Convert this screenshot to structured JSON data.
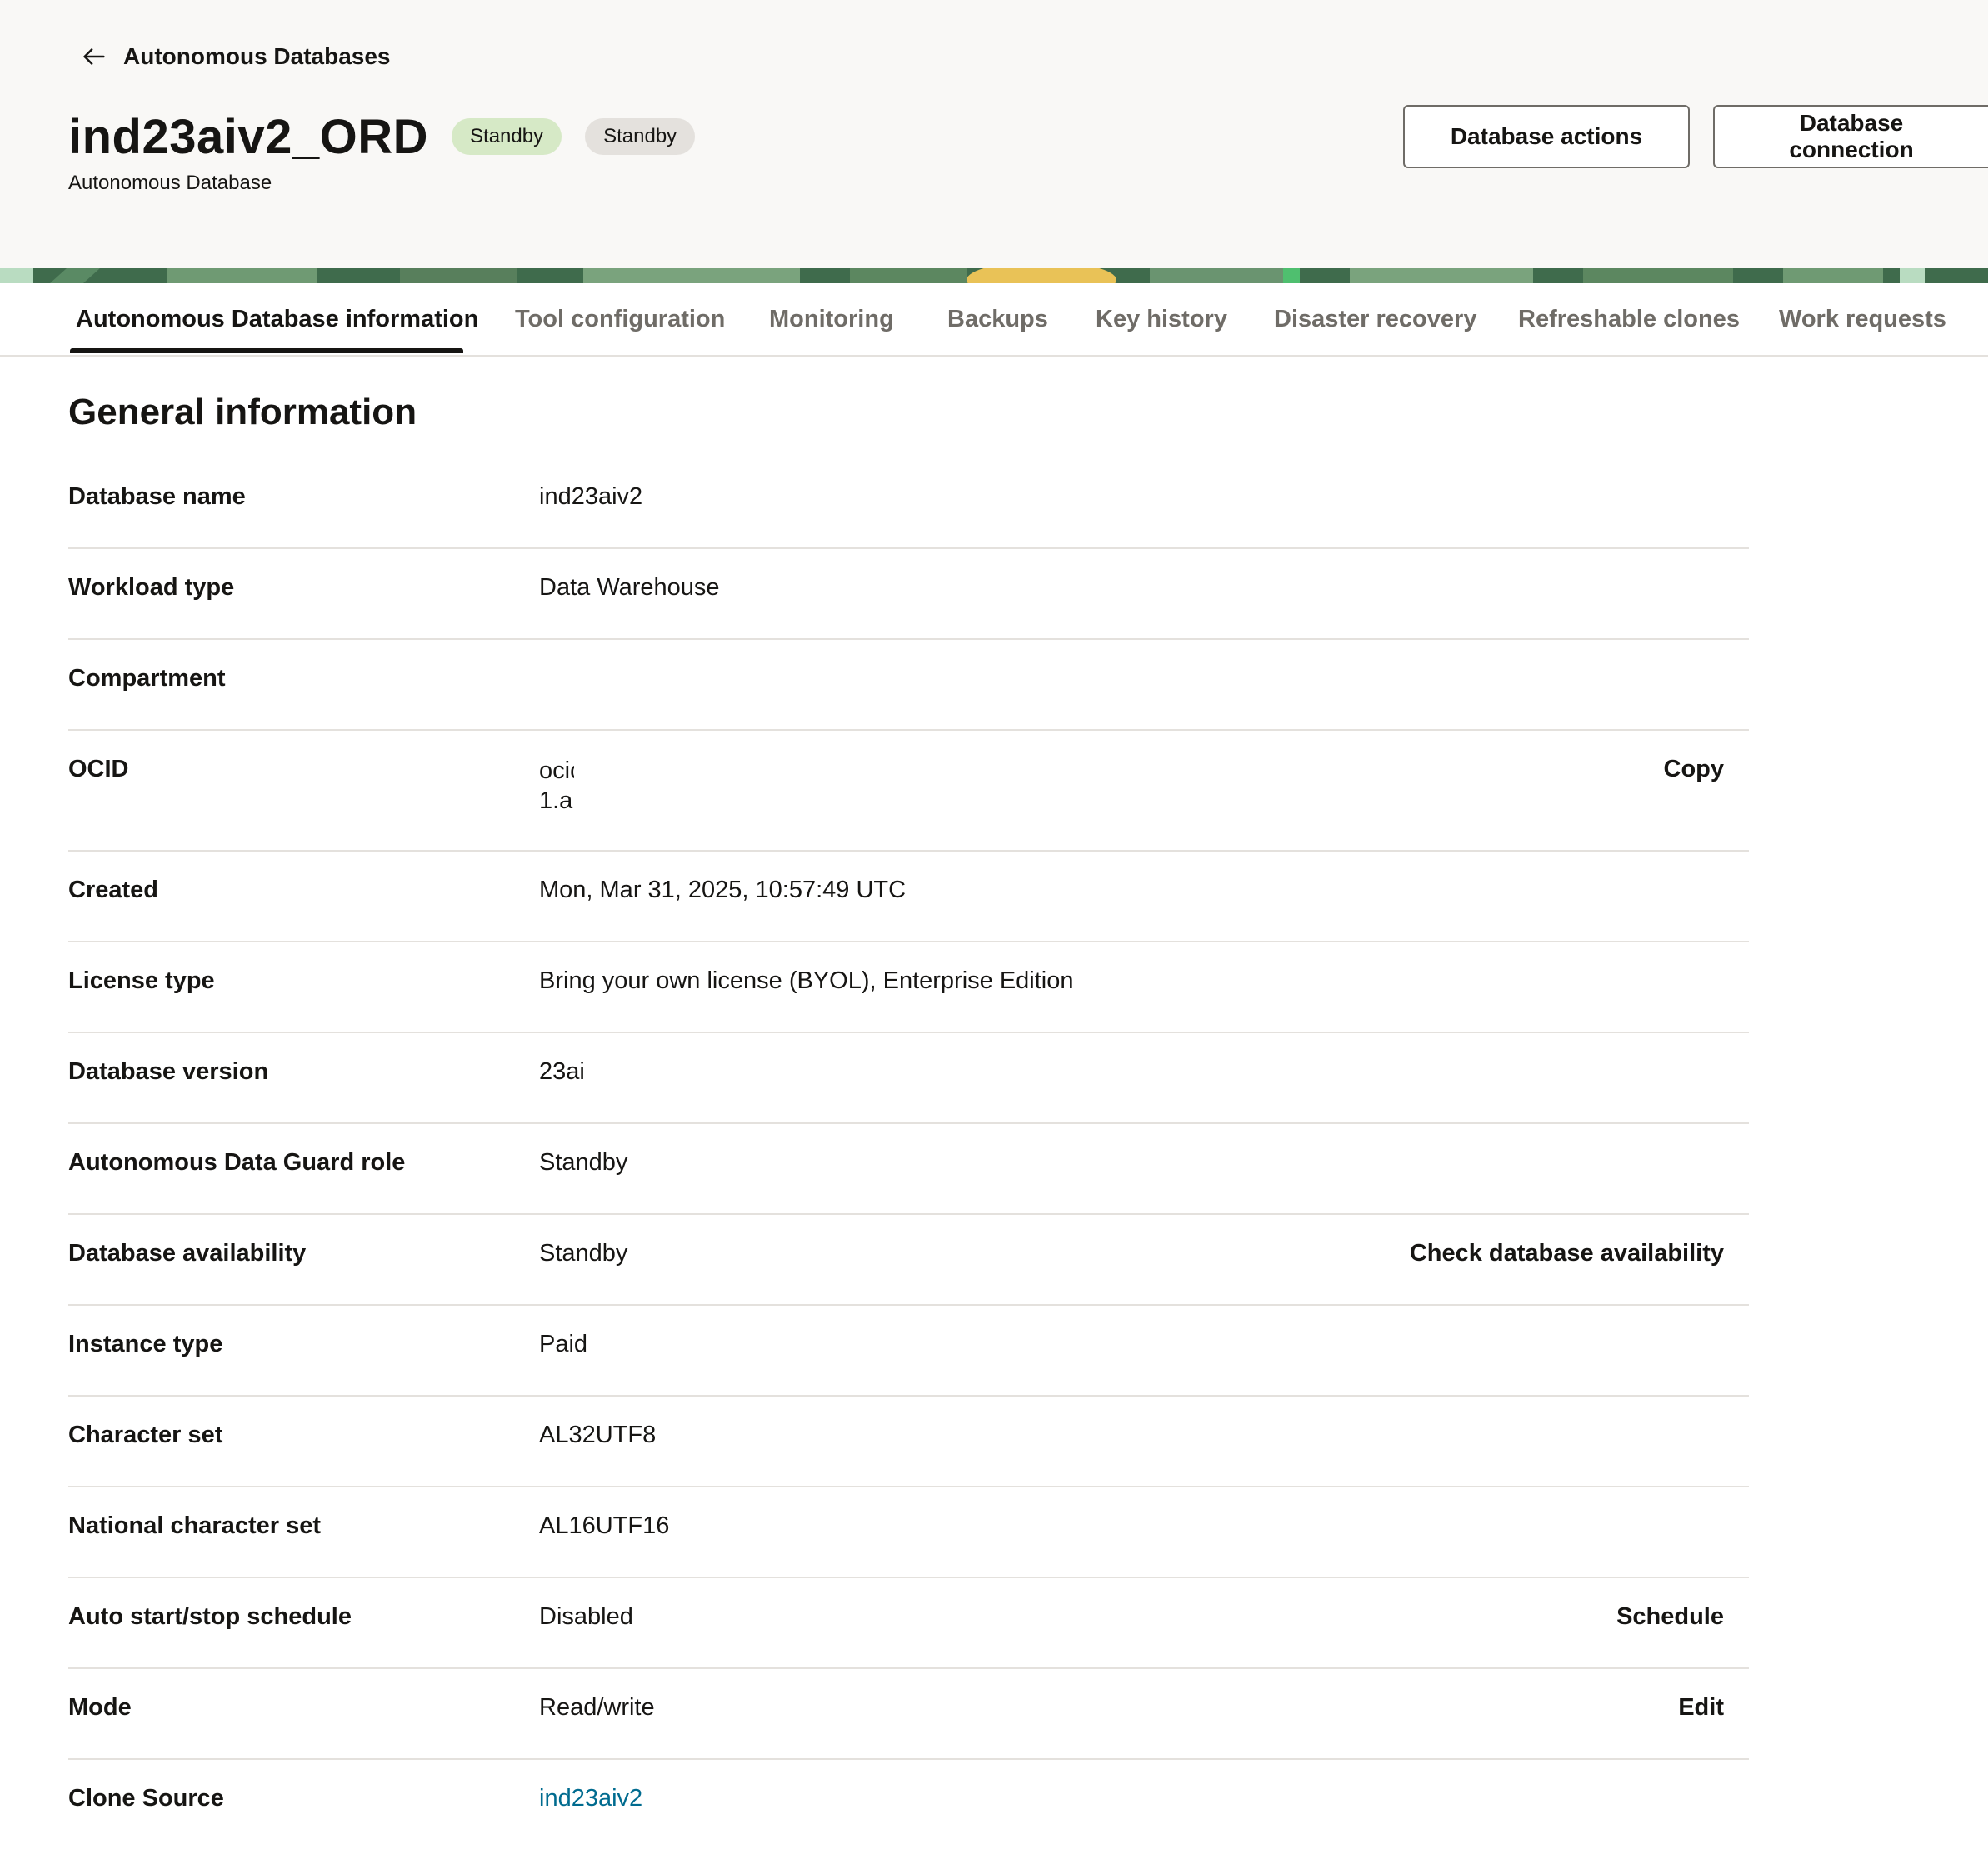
{
  "header": {
    "back_label": "Autonomous Databases",
    "title": "ind23aiv2_ORD",
    "badges": [
      {
        "label": "Standby",
        "color": "#d6e9c6"
      },
      {
        "label": "Standby",
        "color": "#e4e1dd"
      }
    ],
    "subtitle": "Autonomous Database",
    "actions": {
      "database_actions": "Database actions",
      "database_connection": "Database connection"
    },
    "icons": {
      "back": "arrow-left-icon"
    }
  },
  "tabs": [
    {
      "label": "Autonomous Database information",
      "active": true
    },
    {
      "label": "Tool configuration",
      "active": false
    },
    {
      "label": "Monitoring",
      "active": false
    },
    {
      "label": "Backups",
      "active": false
    },
    {
      "label": "Key history",
      "active": false
    },
    {
      "label": "Disaster recovery",
      "active": false
    },
    {
      "label": "Refreshable clones",
      "active": false
    },
    {
      "label": "Work requests",
      "active": false
    }
  ],
  "general": {
    "title": "General information",
    "rows": [
      {
        "label": "Database name",
        "value": "ind23aiv2"
      },
      {
        "label": "Workload type",
        "value": "Data Warehouse"
      },
      {
        "label": "Compartment",
        "value": ""
      },
      {
        "label": "OCID",
        "value_lines": [
          "ocid",
          "1.a"
        ],
        "action": "Copy"
      },
      {
        "label": "Created",
        "value": "Mon, Mar 31, 2025, 10:57:49 UTC"
      },
      {
        "label": "License type",
        "value": "Bring your own license (BYOL), Enterprise Edition"
      },
      {
        "label": "Database version",
        "value": "23ai"
      },
      {
        "label": "Autonomous Data Guard role",
        "value": "Standby"
      },
      {
        "label": "Database availability",
        "value": "Standby",
        "action": "Check database availability"
      },
      {
        "label": "Instance type",
        "value": "Paid"
      },
      {
        "label": "Character set",
        "value": "AL32UTF8"
      },
      {
        "label": "National character set",
        "value": "AL16UTF16"
      },
      {
        "label": "Auto start/stop schedule",
        "value": "Disabled",
        "action": "Schedule"
      },
      {
        "label": "Mode",
        "value": "Read/write",
        "action": "Edit"
      },
      {
        "label": "Clone Source",
        "value": "ind23aiv2"
      }
    ]
  },
  "colors": {
    "link": "#006b8f",
    "badge_green": "#d6e9c6",
    "badge_grey": "#e4e1dd",
    "header_bg": "#f9f8f6"
  }
}
